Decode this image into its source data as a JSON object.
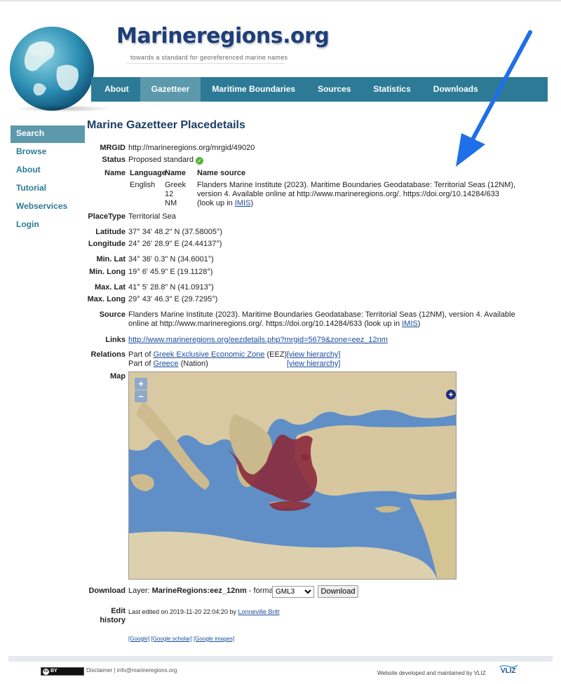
{
  "header": {
    "title": "Marineregions.org",
    "subtitle": "towards a standard for georeferenced marine names"
  },
  "nav": [
    "About",
    "Gazetteer",
    "Maritime Boundaries",
    "Sources",
    "Statistics",
    "Downloads"
  ],
  "sidebar": [
    "Search",
    "Browse",
    "About",
    "Tutorial",
    "Webservices",
    "Login"
  ],
  "page_title": "Marine Gazetteer Placedetails",
  "details": {
    "mrgid_label": "MRGID",
    "mrgid_value": "http://marineregions.org/mrgid/49020",
    "status_label": "Status",
    "status_value": "Proposed standard",
    "name_label": "Name",
    "name_table": {
      "headers": [
        "Language",
        "Name",
        "Name source"
      ],
      "language": "English",
      "name_line1": "Greek",
      "name_line2": "12 NM",
      "source_line1": "Flanders Marine Institute (2023). Maritime Boundaries Geodatabase: Territorial Seas (12NM),",
      "source_line2": "version 4. Available online at http://www.marineregions.org/. https://doi.org/10.14284/633",
      "source_line3_pre": "(look up in ",
      "source_line3_link": "IMIS",
      "source_line3_post": ")"
    },
    "placetype_label": "PlaceType",
    "placetype_value": "Territorial Sea",
    "latitude_label": "Latitude",
    "latitude_value": "37° 34' 48.2\" N (37.58005°)",
    "longitude_label": "Longitude",
    "longitude_value": "24° 26' 28.9\" E (24.44137°)",
    "minlat_label": "Min. Lat",
    "minlat_value": "34° 36' 0.3\" N (34.6001°)",
    "minlong_label": "Min. Long",
    "minlong_value": "19° 6' 45.9\" E (19.1128°)",
    "maxlat_label": "Max. Lat",
    "maxlat_value": "41° 5' 28.8\" N (41.0913°)",
    "maxlong_label": "Max. Long",
    "maxlong_value": "29° 43' 46.3\" E (29.7295°)",
    "source_label": "Source",
    "source_line1": "Flanders Marine Institute (2023). Maritime Boundaries Geodatabase: Territorial Seas (12NM), version 4. Available",
    "source_line2_pre": "online at http://www.marineregions.org/. https://doi.org/10.14284/633 (look up in ",
    "source_line2_link": "IMIS",
    "source_line2_post": ")",
    "links_label": "Links",
    "links_value": "http://www.marineregions.org/eezdetails.php?mrgid=5679&zone=eez_12nm",
    "relations_label": "Relations",
    "relations": [
      {
        "prefix": "Part of",
        "link": "Greek Exclusive Economic Zone",
        "suffix": "(EEZ)",
        "hierarchy": "[view hierarchy]"
      },
      {
        "prefix": "Part of",
        "link": "Greece",
        "suffix": "(Nation)",
        "hierarchy": "[view hierarchy]"
      }
    ],
    "map_label": "Map",
    "map_zoom_in": "+",
    "map_zoom_out": "−",
    "map_layer_switch": "+",
    "download_label": "Download",
    "download_layer_pre": "Layer: ",
    "download_layer": "MarineRegions:eez_12nm",
    "download_format_pre": " - format:",
    "download_format": "GML3",
    "download_button": "Download",
    "edit_label_1": "Edit",
    "edit_label_2": "history",
    "edit_pre": "Last edited on 2019-11-20 22:04:20 by ",
    "edit_user": "Lonneville Britt",
    "search_links": [
      "[Google]",
      "[Google scholar]",
      "[Google images]"
    ]
  },
  "footer": {
    "cc_label": "BY",
    "left": "Disclaimer | info@marineregions.org",
    "right": "Website developed and maintained by VLIZ",
    "logo": "VLIZ"
  },
  "colors": {
    "nav_bg": "#2c7a95",
    "nav_active": "#5c99ad",
    "title": "#1d3f66",
    "link": "#1a4c9c",
    "arrow": "#1f6fe8",
    "territorial_sea": "#8a2a3c"
  }
}
